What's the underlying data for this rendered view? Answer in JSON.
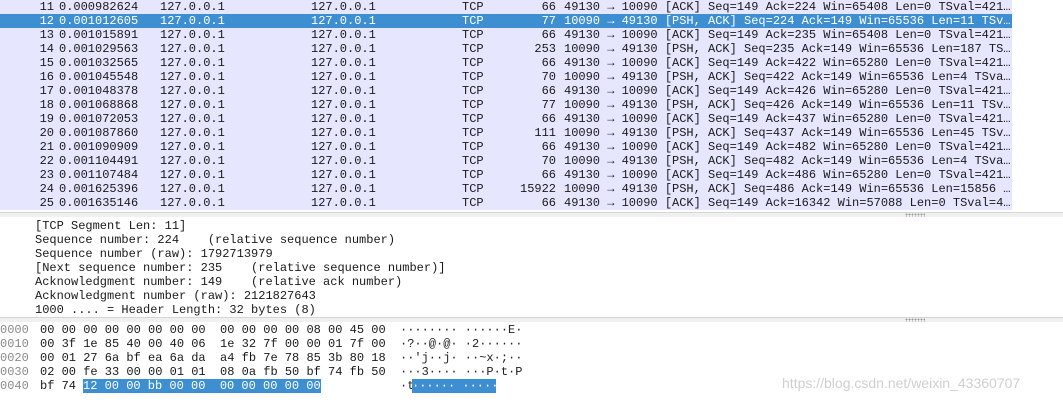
{
  "packets": [
    {
      "no": "11",
      "time": "0.000982624",
      "src": "127.0.0.1",
      "dst": "127.0.0.1",
      "proto": "TCP",
      "len": "66",
      "info": "49130 → 10090 [ACK] Seq=149 Ack=224 Win=65408 Len=0 TSval=421…",
      "selected": false
    },
    {
      "no": "12",
      "time": "0.001012605",
      "src": "127.0.0.1",
      "dst": "127.0.0.1",
      "proto": "TCP",
      "len": "77",
      "info": "10090 → 49130 [PSH, ACK] Seq=224 Ack=149 Win=65536 Len=11 TSv…",
      "selected": true
    },
    {
      "no": "13",
      "time": "0.001015891",
      "src": "127.0.0.1",
      "dst": "127.0.0.1",
      "proto": "TCP",
      "len": "66",
      "info": "49130 → 10090 [ACK] Seq=149 Ack=235 Win=65408 Len=0 TSval=421…",
      "selected": false
    },
    {
      "no": "14",
      "time": "0.001029563",
      "src": "127.0.0.1",
      "dst": "127.0.0.1",
      "proto": "TCP",
      "len": "253",
      "info": "10090 → 49130 [PSH, ACK] Seq=235 Ack=149 Win=65536 Len=187 TS…",
      "selected": false
    },
    {
      "no": "15",
      "time": "0.001032565",
      "src": "127.0.0.1",
      "dst": "127.0.0.1",
      "proto": "TCP",
      "len": "66",
      "info": "49130 → 10090 [ACK] Seq=149 Ack=422 Win=65280 Len=0 TSval=421…",
      "selected": false
    },
    {
      "no": "16",
      "time": "0.001045548",
      "src": "127.0.0.1",
      "dst": "127.0.0.1",
      "proto": "TCP",
      "len": "70",
      "info": "10090 → 49130 [PSH, ACK] Seq=422 Ack=149 Win=65536 Len=4 TSva…",
      "selected": false
    },
    {
      "no": "17",
      "time": "0.001048378",
      "src": "127.0.0.1",
      "dst": "127.0.0.1",
      "proto": "TCP",
      "len": "66",
      "info": "49130 → 10090 [ACK] Seq=149 Ack=426 Win=65280 Len=0 TSval=421…",
      "selected": false
    },
    {
      "no": "18",
      "time": "0.001068868",
      "src": "127.0.0.1",
      "dst": "127.0.0.1",
      "proto": "TCP",
      "len": "77",
      "info": "10090 → 49130 [PSH, ACK] Seq=426 Ack=149 Win=65536 Len=11 TSv…",
      "selected": false
    },
    {
      "no": "19",
      "time": "0.001072053",
      "src": "127.0.0.1",
      "dst": "127.0.0.1",
      "proto": "TCP",
      "len": "66",
      "info": "49130 → 10090 [ACK] Seq=149 Ack=437 Win=65280 Len=0 TSval=421…",
      "selected": false
    },
    {
      "no": "20",
      "time": "0.001087860",
      "src": "127.0.0.1",
      "dst": "127.0.0.1",
      "proto": "TCP",
      "len": "111",
      "info": "10090 → 49130 [PSH, ACK] Seq=437 Ack=149 Win=65536 Len=45 TSv…",
      "selected": false
    },
    {
      "no": "21",
      "time": "0.001090909",
      "src": "127.0.0.1",
      "dst": "127.0.0.1",
      "proto": "TCP",
      "len": "66",
      "info": "49130 → 10090 [ACK] Seq=149 Ack=482 Win=65280 Len=0 TSval=421…",
      "selected": false
    },
    {
      "no": "22",
      "time": "0.001104491",
      "src": "127.0.0.1",
      "dst": "127.0.0.1",
      "proto": "TCP",
      "len": "70",
      "info": "10090 → 49130 [PSH, ACK] Seq=482 Ack=149 Win=65536 Len=4 TSva…",
      "selected": false
    },
    {
      "no": "23",
      "time": "0.001107484",
      "src": "127.0.0.1",
      "dst": "127.0.0.1",
      "proto": "TCP",
      "len": "66",
      "info": "49130 → 10090 [ACK] Seq=149 Ack=486 Win=65280 Len=0 TSval=421…",
      "selected": false
    },
    {
      "no": "24",
      "time": "0.001625396",
      "src": "127.0.0.1",
      "dst": "127.0.0.1",
      "proto": "TCP",
      "len": "15922",
      "info": "10090 → 49130 [PSH, ACK] Seq=486 Ack=149 Win=65536 Len=15856 …",
      "selected": false
    },
    {
      "no": "25",
      "time": "0.001635146",
      "src": "127.0.0.1",
      "dst": "127.0.0.1",
      "proto": "TCP",
      "len": "66",
      "info": "49130 → 10090 [ACK] Seq=149 Ack=16342 Win=57088 Len=0 TSval=4…",
      "selected": false
    }
  ],
  "details": [
    "[TCP Segment Len: 11]",
    "Sequence number: 224    (relative sequence number)",
    "Sequence number (raw): 1792713979",
    "[Next sequence number: 235    (relative sequence number)]",
    "Acknowledgment number: 149    (relative ack number)",
    "Acknowledgment number (raw): 2121827643",
    "1000 .... = Header Length: 32 bytes (8)"
  ],
  "bytes": [
    {
      "offset": "0000",
      "hex": "00 00 00 00 00 00 00 00  00 00 00 00 08 00 45 00",
      "hex_sel": "",
      "ascii": "········ ······E·",
      "ascii_sel": ""
    },
    {
      "offset": "0010",
      "hex": "00 3f 1e 85 40 00 40 06  1e 32 7f 00 00 01 7f 00",
      "hex_sel": "",
      "ascii": "·?··@·@· ·2······",
      "ascii_sel": ""
    },
    {
      "offset": "0020",
      "hex": "00 01 27 6a bf ea 6a da  a4 fb 7e 78 85 3b 80 18",
      "hex_sel": "",
      "ascii": "··'j··j· ··~x·;··",
      "ascii_sel": ""
    },
    {
      "offset": "0030",
      "hex": "02 00 fe 33 00 00 01 01  08 0a fb 50 bf 74 fb 50",
      "hex_sel": "",
      "ascii": "···3···· ···P·t·P",
      "ascii_sel": ""
    },
    {
      "offset": "0040",
      "hex": "bf 74",
      "hex_sel": "12 00 00 bb 00 00  00 00 00 00 00",
      "ascii": "·t",
      "ascii_sel": "······ ·····"
    }
  ],
  "watermark": "https://blog.csdn.net/weixin_43360707",
  "colors": {
    "row_bg": "#e7e6ff",
    "selected_bg": "#3d8fd1",
    "selected_fg": "#ffffff"
  }
}
